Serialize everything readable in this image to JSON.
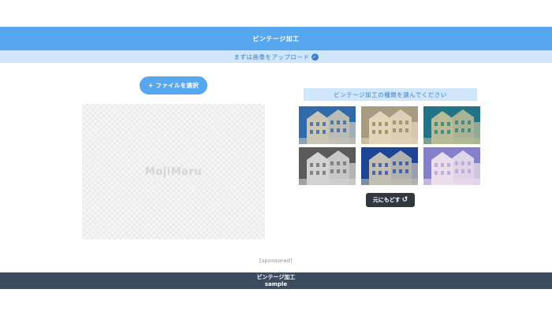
{
  "header": {
    "title": "ビンテージ加工"
  },
  "subbar": {
    "text": "まずは画像をアップロード",
    "icon": "check-circle-icon"
  },
  "upload": {
    "label": "+ ファイルを選択"
  },
  "preview": {
    "logo": "MojiMaru"
  },
  "filters": {
    "label": "ビンテージ加工の種類を選んでください",
    "thumbnails": [
      {
        "name": "filter-1",
        "sky": "#2f6aa8",
        "ground": "#ead9b8",
        "tint": "#3a6fb0"
      },
      {
        "name": "filter-2",
        "sky": "#a9a08a",
        "ground": "#efe6cf",
        "tint": "#a08d60"
      },
      {
        "name": "filter-3",
        "sky": "#1f6f86",
        "ground": "#d6c79a",
        "tint": "#2a8a8a"
      },
      {
        "name": "filter-4",
        "sky": "#555555",
        "ground": "#e8e8e8",
        "tint": "#777777"
      },
      {
        "name": "filter-5",
        "sky": "#1c3f8f",
        "ground": "#e3d4b2",
        "tint": "#2f5cb8"
      },
      {
        "name": "filter-6",
        "sky": "#7a78c8",
        "ground": "#f6eaf0",
        "tint": "#b8a8e0"
      }
    ]
  },
  "revert": {
    "label": "元にもどす",
    "icon": "undo-icon"
  },
  "sponsored": {
    "text": "[sponsored]"
  },
  "footer": {
    "title": "ビンテージ加工",
    "subtitle": "sample"
  }
}
